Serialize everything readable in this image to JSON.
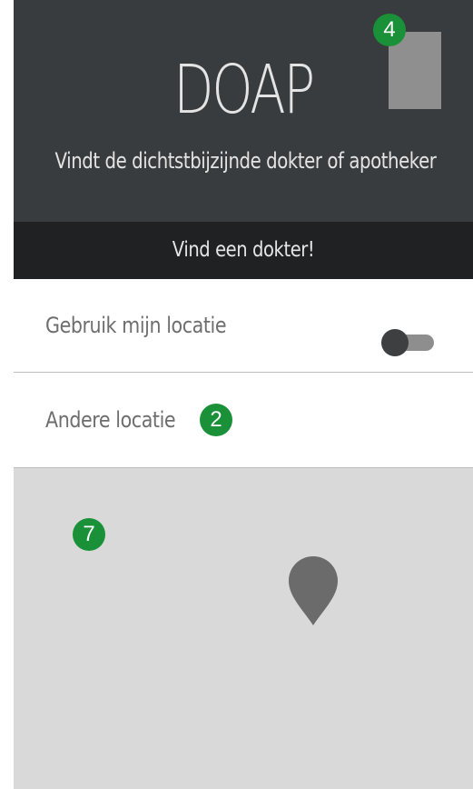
{
  "header": {
    "title": "DOAP",
    "subtitle": "Vindt de dichtstbijzijnde dokter of apotheker",
    "background_color": "#393c3f"
  },
  "find_button": {
    "label": "Vind een dokter!"
  },
  "location_options": [
    {
      "label": "Gebruik mijn locatie",
      "toggle_on": false
    },
    {
      "label": "Andere locatie"
    }
  ],
  "annotations": {
    "square_button_badge": "4",
    "other_location_badge": "2",
    "map_badge": "7",
    "badge_color": "#1a9138"
  },
  "map": {
    "background_color": "#d9d9d9",
    "pin_icon": "map-pin-icon"
  }
}
